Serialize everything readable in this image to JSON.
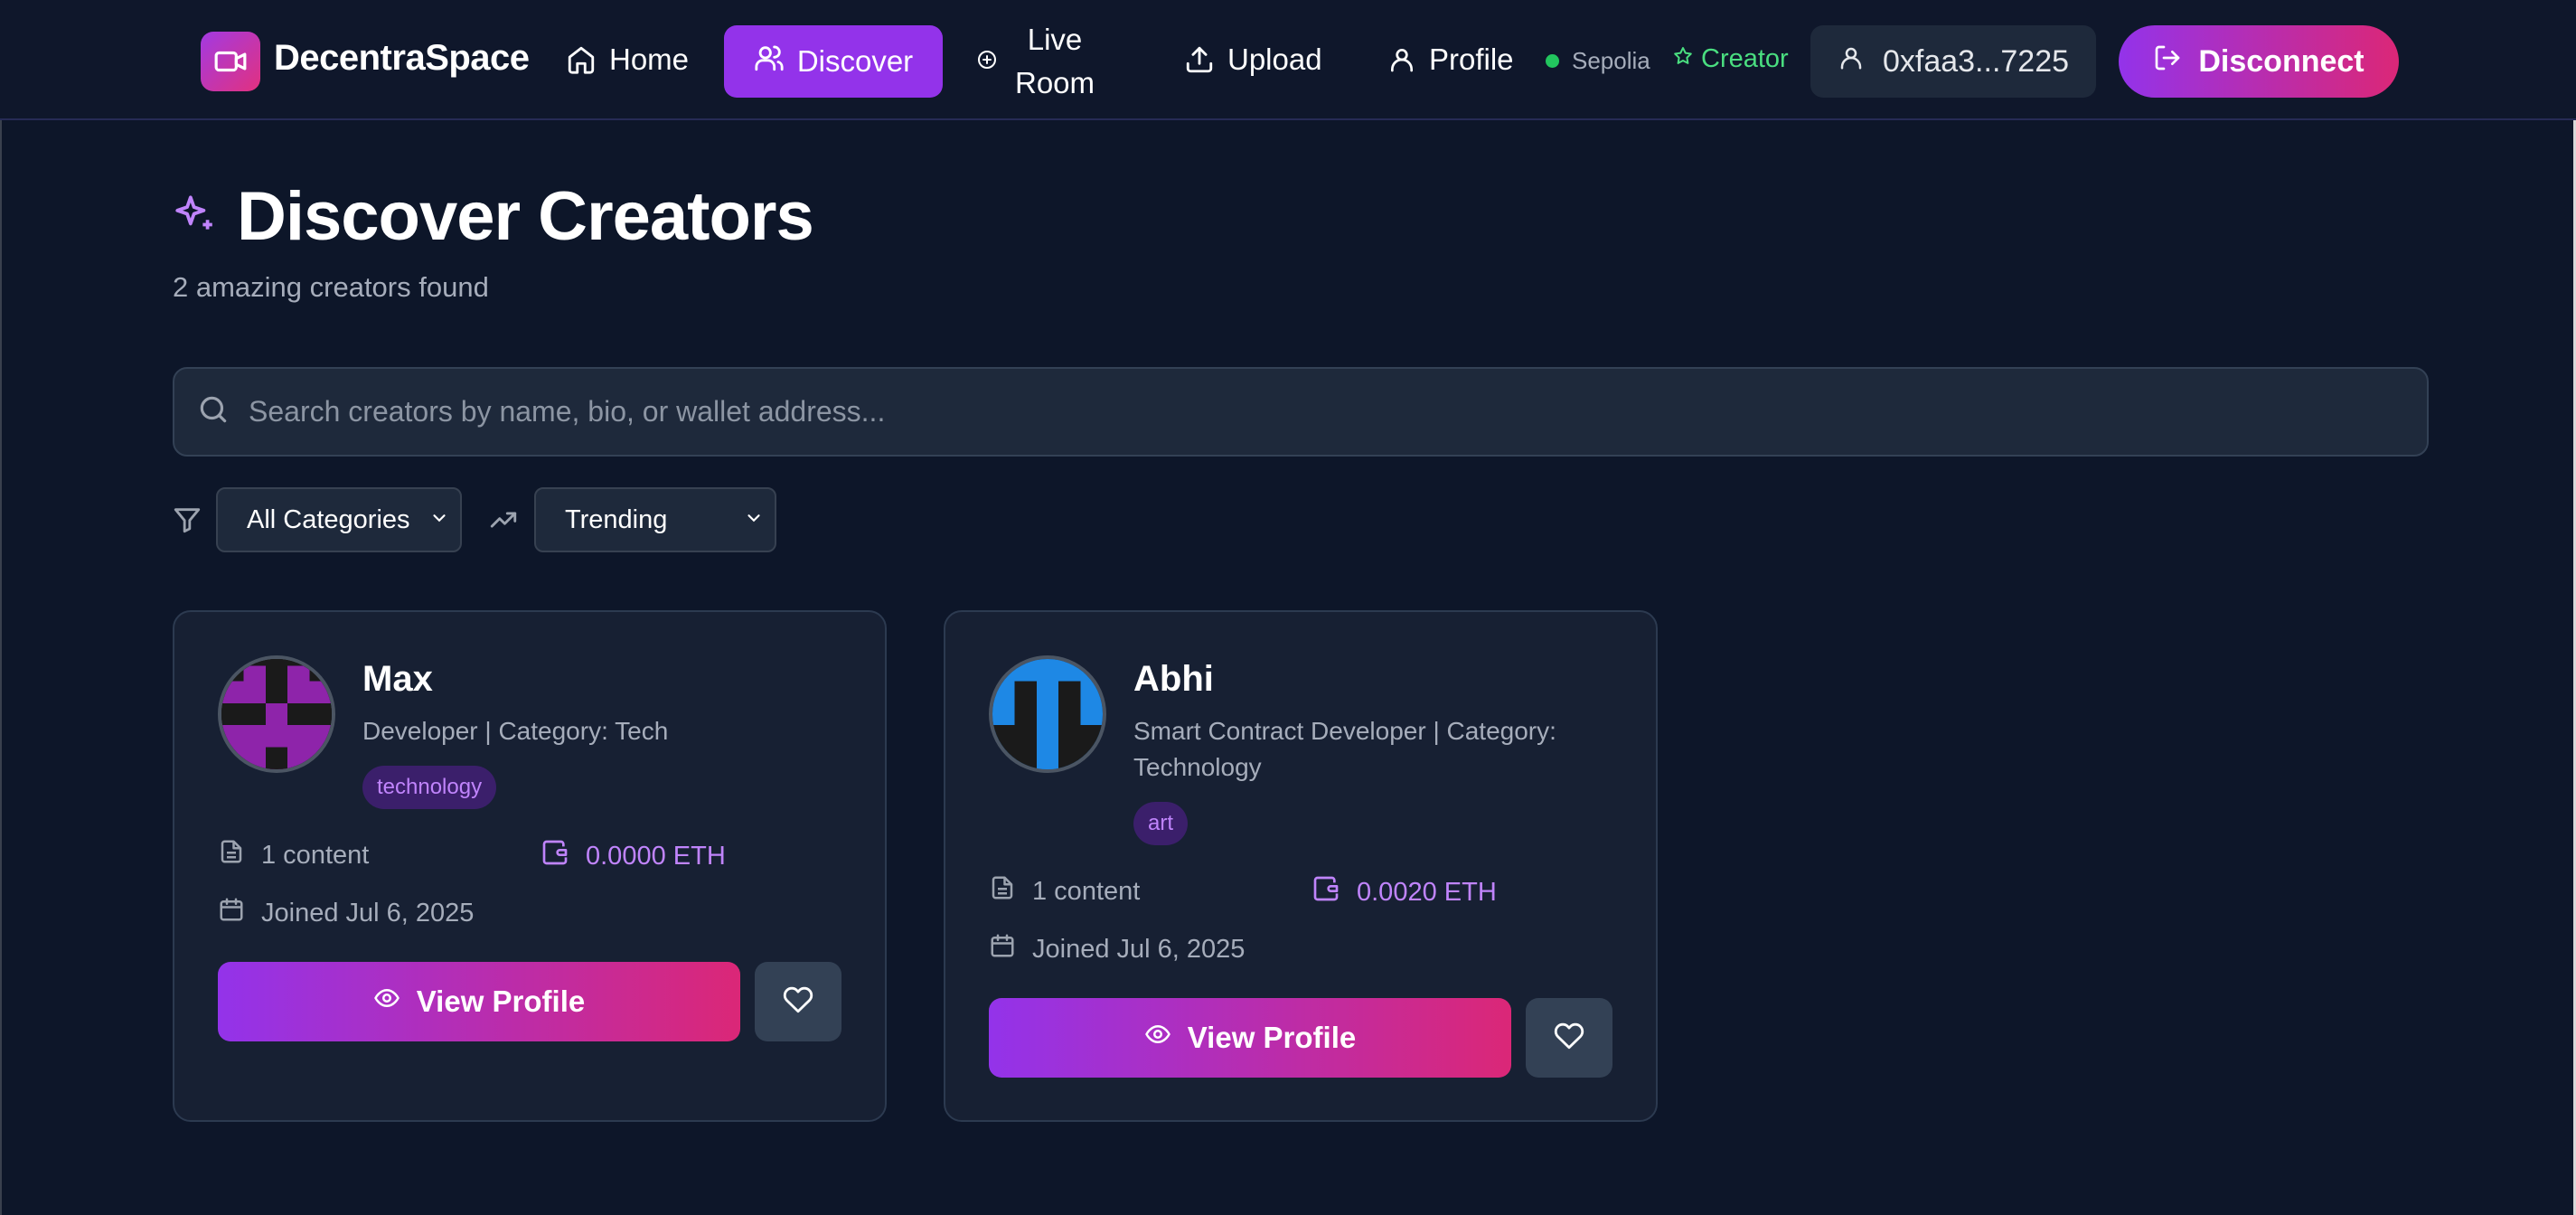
{
  "app": {
    "brand": "DecentraSpace"
  },
  "nav": {
    "home": "Home",
    "discover": "Discover",
    "live_room": "Live Room",
    "upload": "Upload",
    "profile": "Profile",
    "network": "Sepolia",
    "role": "Creator",
    "wallet": "0xfaa3...7225",
    "disconnect": "Disconnect"
  },
  "header": {
    "title": "Discover Creators",
    "subtitle": "2 amazing creators found"
  },
  "search": {
    "value": "",
    "placeholder": "Search creators by name, bio, or wallet address..."
  },
  "filters": {
    "category": "All Categories",
    "sort": "Trending"
  },
  "creators": [
    {
      "name": "Max",
      "bio": "Developer | Category: Tech",
      "tag": "technology",
      "content": "1 content",
      "earnings": "0.0000 ETH",
      "joined": "Joined Jul 6, 2025",
      "view_label": "View Profile",
      "avatar_color": "#8e24aa"
    },
    {
      "name": "Abhi",
      "bio": "Smart Contract Developer | Category: Technology",
      "tag": "art",
      "content": "1 content",
      "earnings": "0.0020 ETH",
      "joined": "Joined Jul 6, 2025",
      "view_label": "View Profile",
      "avatar_color": "#1e88e5"
    }
  ],
  "colors": {
    "background": "#0d1629",
    "accent": "#9333ea",
    "accent_pink": "#db2777",
    "online": "#22c55e",
    "creator": "#4ade80"
  }
}
